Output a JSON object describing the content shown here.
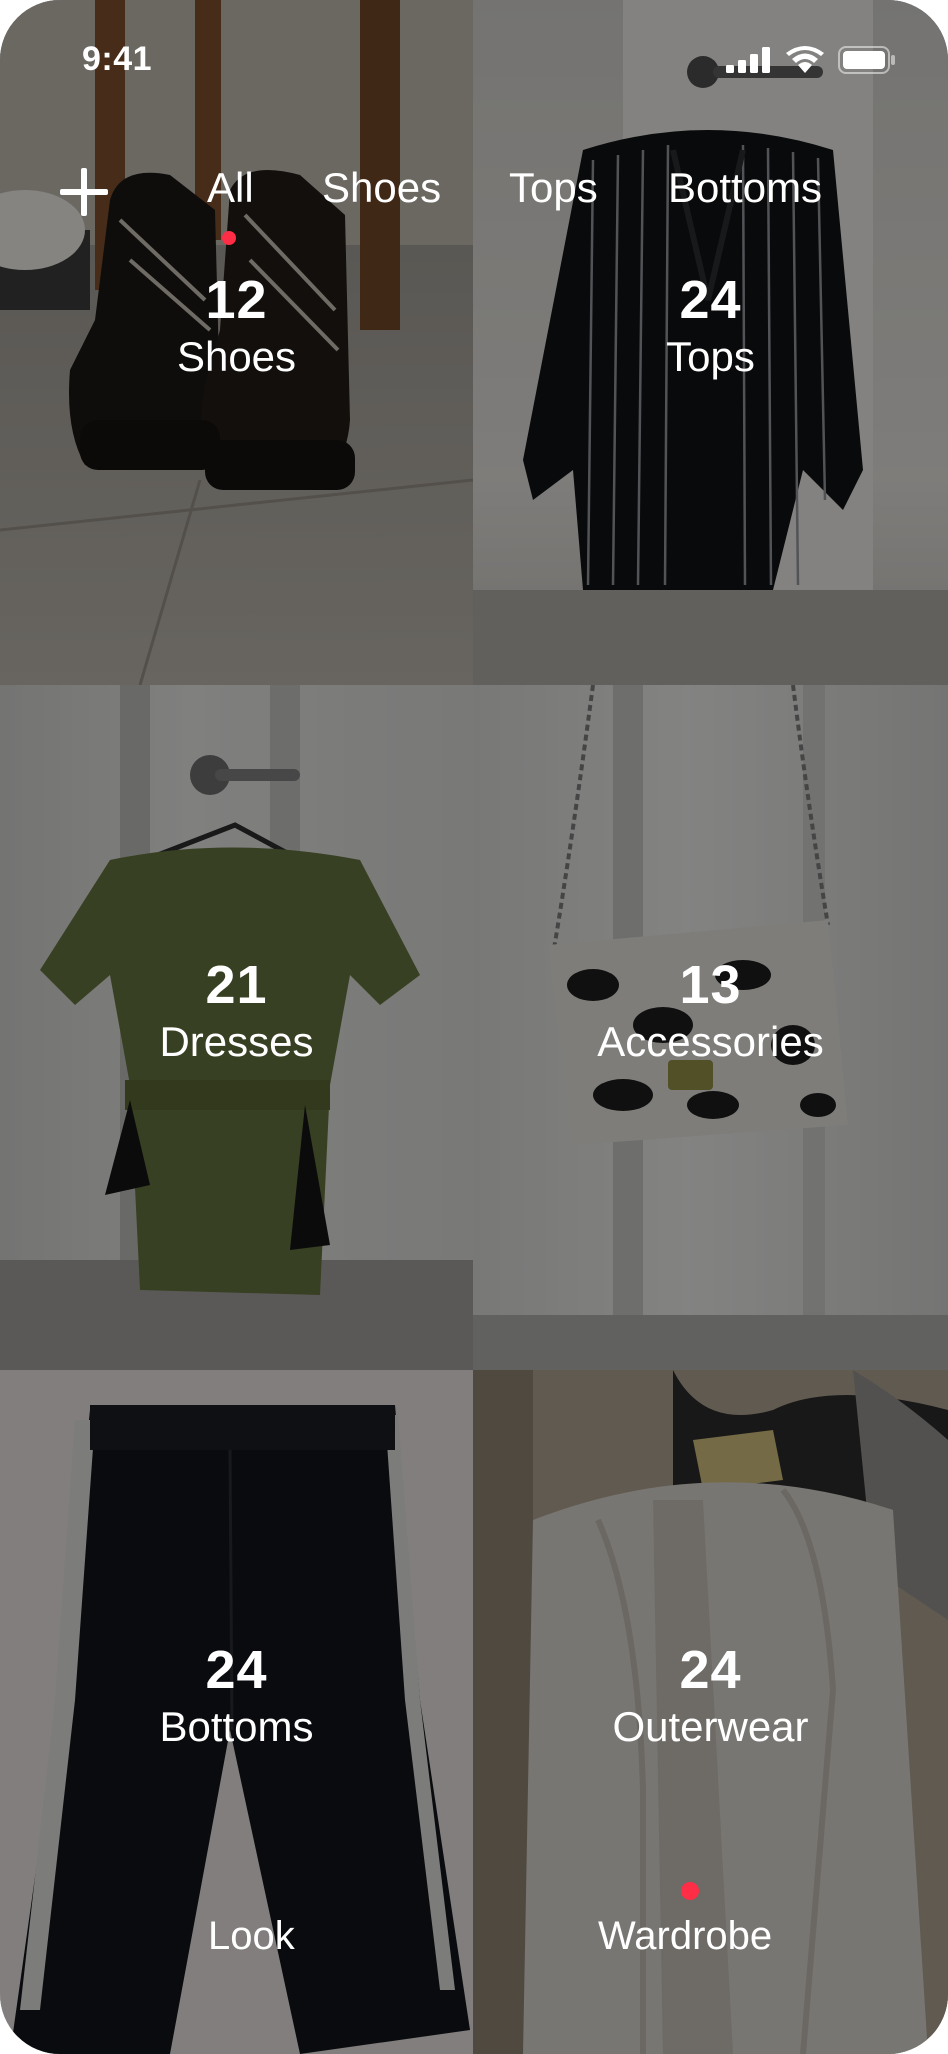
{
  "status_bar": {
    "time": "9:41",
    "icons": [
      "cellular-signal-icon",
      "wifi-icon",
      "battery-icon"
    ]
  },
  "top_nav": {
    "add_icon": "plus-icon",
    "tabs": [
      {
        "label": "All",
        "selected": true
      },
      {
        "label": "Shoes",
        "selected": false
      },
      {
        "label": "Tops",
        "selected": false
      },
      {
        "label": "Bottoms",
        "selected": false
      }
    ]
  },
  "categories": [
    {
      "count": "12",
      "name": "Shoes"
    },
    {
      "count": "24",
      "name": "Tops"
    },
    {
      "count": "21",
      "name": "Dresses"
    },
    {
      "count": "13",
      "name": "Accessories"
    },
    {
      "count": "24",
      "name": "Bottoms"
    },
    {
      "count": "24",
      "name": "Outerwear"
    }
  ],
  "bottom_nav": {
    "tabs": [
      {
        "label": "Look",
        "selected": false
      },
      {
        "label": "Wardrobe",
        "selected": true
      }
    ]
  },
  "colors": {
    "accent": "#ff2d46",
    "text": "#ffffff"
  }
}
